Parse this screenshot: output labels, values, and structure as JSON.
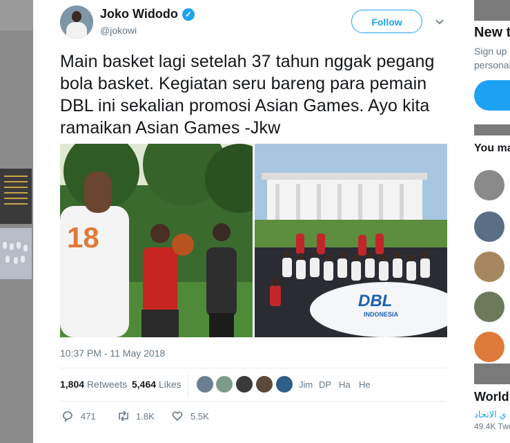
{
  "tweet": {
    "author_name": "Joko Widodo",
    "handle": "@jokowi",
    "follow_label": "Follow",
    "text": "Main basket lagi setelah 37 tahun nggak pegang bola basket. Kegiatan seru bareng para pemain DBL ini sekalian promosi Asian Games. Ayo kita ramaikan Asian Games  -Jkw",
    "timestamp": "10:37 PM - 11 May 2018",
    "retweets_count": "1,804",
    "retweets_label": "Retweets",
    "likes_count": "5,464",
    "likes_label": "Likes",
    "likers": [
      "Jim",
      "DP",
      "Ha",
      "He"
    ],
    "replies": "471",
    "retweets_short": "1.8K",
    "likes_short": "5.5K",
    "photo2_logo": "DBL",
    "photo2_logo_sub": "INDONESIA",
    "jersey_number": "18"
  },
  "sidebar": {
    "new_title": "New t",
    "signup_text": "Sign up",
    "personal_text": "personal",
    "you_may": "You ma",
    "world_title": "World",
    "arabic_text": "ي الاتحاد",
    "tweets_count": "49.4K Twe"
  },
  "colors": {
    "accent": "#1da1f2",
    "text": "#14171a",
    "muted": "#657786",
    "overlay": "#7b7b7b"
  }
}
